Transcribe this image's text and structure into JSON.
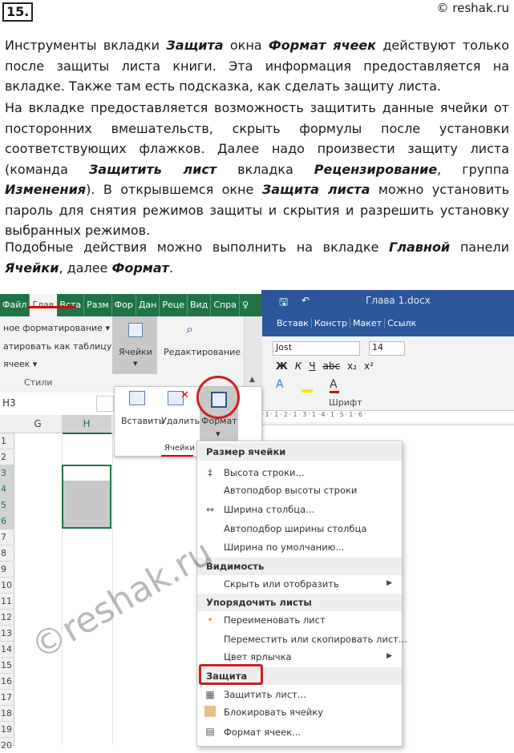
{
  "header": {
    "number": "15.",
    "copyright": "© reshak.ru"
  },
  "paragraphs": {
    "p1": {
      "a": "Инструменты вкладки ",
      "b1": "Защита",
      "c": " окна ",
      "b2": "Формат ячеек",
      "d": " действуют только после защиты листа книги. Эта информация предоставляется на вкладке. Также там есть подсказка, как сделать защиту листа."
    },
    "p2": {
      "a": "На вкладке предоставляется возможность защитить данные ячейки от посторонних вмешательств, скрыть формулы после установки соответствующих флажков. Далее надо произвести защиту листа (команда ",
      "b1": "Защитить лист",
      "c": " вкладка ",
      "b2": "Рецензирование",
      "d": ", группа ",
      "b3": "Изменения",
      "e": "). В открывшемся окне ",
      "b4": "Защита листа",
      "f": " можно установить пароль для снятия режимов защиты и скрытия и разрешить установку выбранных режимов."
    },
    "p3": {
      "a": "Подобные действия можно выполнить на вкладке ",
      "b1": "Главной",
      "c": " панели ",
      "b2": "Ячейки",
      "d": ", далее ",
      "b3": "Формат",
      "e": "."
    }
  },
  "excel": {
    "tabs": [
      "Файл",
      "Глав",
      "Вста",
      "Разм",
      "Фор",
      "Дан",
      "Реце",
      "Вид",
      "Спра"
    ],
    "ribbon": {
      "styles_item1": "ное форматирование ▾",
      "styles_item2": "атировать как таблицу ▾",
      "styles_item3": "ячеек ▾",
      "styles_group": "Стили",
      "cells_label": "Ячейки",
      "editing_label": "Редактирование"
    },
    "name_box": "H3",
    "cells_dropdown": {
      "insert": "Вставить",
      "delete": "Удалить",
      "format": "Формат",
      "group": "Ячейки"
    },
    "columns": [
      "G",
      "H"
    ],
    "rows": [
      "1",
      "2",
      "3",
      "4",
      "5",
      "6",
      "7",
      "8",
      "9",
      "10",
      "11",
      "12",
      "13",
      "14",
      "15",
      "16",
      "17",
      "18",
      "19",
      "20"
    ]
  },
  "word": {
    "title": "Глава 1.docx",
    "tabs": [
      "Вставк",
      "Констр",
      "Макет",
      "Ссылк"
    ],
    "font_name": "Jost",
    "font_size": "14",
    "font_group": "Шрифт",
    "format_buttons": [
      "Ж",
      "К",
      "Ч",
      "abc",
      "x₂",
      "x²"
    ]
  },
  "menu": {
    "sec1": "Размер ячейки",
    "row_height": "Высота строки...",
    "autofit_row": "Автоподбор высоты строки",
    "col_width": "Ширина столбца...",
    "autofit_col": "Автоподбор ширины столбца",
    "default_width": "Ширина по умолчанию...",
    "sec2": "Видимость",
    "hide_show": "Скрыть или отобразить",
    "sec3": "Упорядочить листы",
    "rename": "Переименовать лист",
    "move_copy": "Переместить или скопировать лист...",
    "tab_color": "Цвет ярлычка",
    "sec4": "Защита",
    "protect_sheet": "Защитить лист...",
    "lock_cell": "Блокировать ячейку",
    "format_cells": "Формат ячеек..."
  },
  "watermark": "©reshak.ru",
  "colors": {
    "excel_green": "#217346",
    "word_blue": "#2b579a",
    "highlight_red": "#cc2020"
  }
}
